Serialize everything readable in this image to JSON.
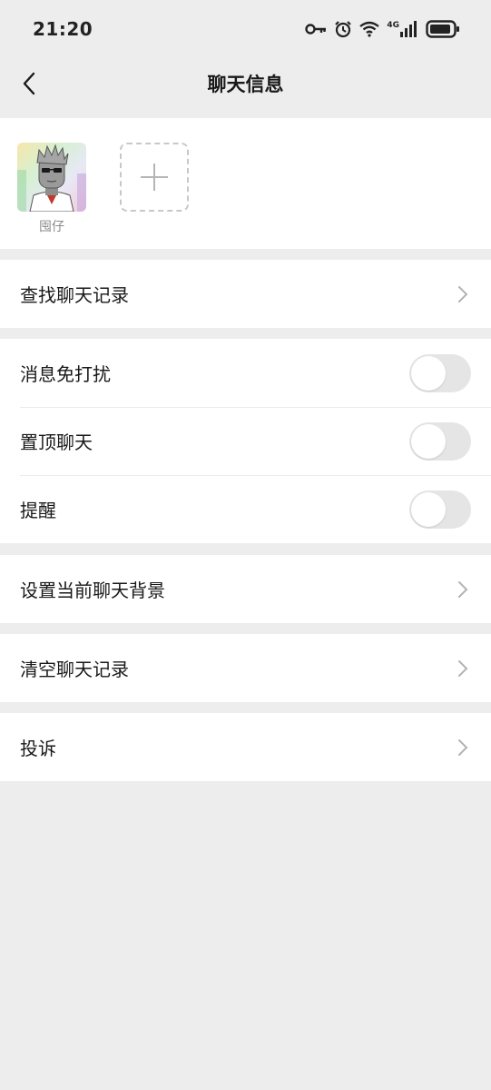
{
  "status_bar": {
    "time": "21:20",
    "network_label": "4G",
    "icons": [
      "key-icon",
      "alarm-icon",
      "wifi-icon",
      "signal-icon",
      "battery-icon"
    ]
  },
  "nav": {
    "title": "聊天信息",
    "back_icon": "back-arrow-icon"
  },
  "members": {
    "list": [
      {
        "name": "囤仔"
      }
    ],
    "add_icon": "plus-icon"
  },
  "menu": {
    "find_history": "查找聊天记录",
    "mute": "消息免打扰",
    "pin": "置顶聊天",
    "remind": "提醒",
    "background": "设置当前聊天背景",
    "clear_history": "清空聊天记录",
    "report": "投诉"
  },
  "toggles": {
    "mute": false,
    "pin": false,
    "remind": false
  },
  "colors": {
    "page_bg": "#ededed",
    "card_bg": "#ffffff",
    "text": "#191919",
    "toggle_off": "#e5e5e5",
    "chevron": "#b2b2b2"
  }
}
